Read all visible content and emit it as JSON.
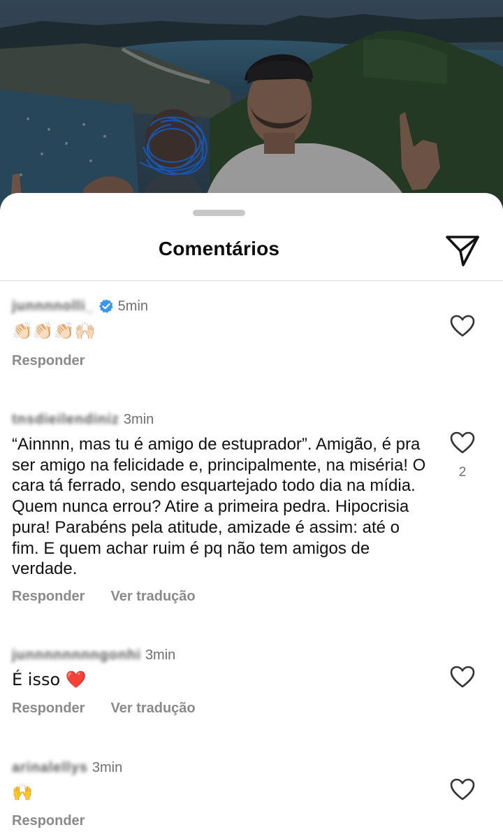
{
  "sheet": {
    "title": "Comentários",
    "share_icon": "paper-plane-icon"
  },
  "comments": [
    {
      "username": "junnnnolli_",
      "verified": true,
      "time": "5min",
      "text": "👏🏻👏🏻👏🏻🙌🏻",
      "reply_label": "Responder",
      "translate_label": "",
      "likes": ""
    },
    {
      "username": "tnsdieilendiniz",
      "verified": false,
      "time": "3min",
      "text": "“Ainnnn, mas tu é amigo de estuprador”. Amigão, é pra ser amigo na felicidade e, principalmente, na miséria! O cara tá ferrado, sendo esquartejado todo dia na mídia. Quem nunca errou? Atire a primeira pedra. Hipocrisia pura! Parabéns pela atitude, amizade é assim: até o fim. E quem achar ruim é pq não tem amigos de verdade.",
      "reply_label": "Responder",
      "translate_label": "Ver tradução",
      "likes": "2"
    },
    {
      "username": "junnnnnnnngonhi",
      "verified": false,
      "time": "3min",
      "text": "É isso ❤️",
      "reply_label": "Responder",
      "translate_label": "Ver tradução",
      "likes": ""
    },
    {
      "username": "arinalellys",
      "verified": false,
      "time": "3min",
      "text": "🙌",
      "reply_label": "Responder",
      "translate_label": "",
      "likes": ""
    }
  ],
  "colors": {
    "verified_badge": "#3897f0",
    "heart_emoji": "#e0245e",
    "secondary_text": "#8a8a8a",
    "scribble": "#1f6fe0"
  }
}
